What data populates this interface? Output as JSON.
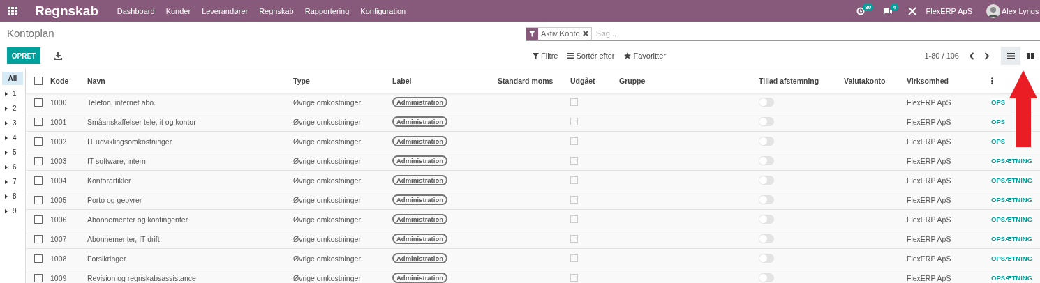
{
  "navbar": {
    "brand": "Regnskab",
    "menu": [
      "Dashboard",
      "Kunder",
      "Leverandører",
      "Regnskab",
      "Rapportering",
      "Konfiguration"
    ],
    "activity_badge": "30",
    "messages_badge": "4",
    "company": "FlexERP ApS",
    "user": "Alex Lyngs"
  },
  "breadcrumb": "Kontoplan",
  "create_button": "OPRET",
  "search": {
    "facet": "Aktiv Konto",
    "placeholder": "Søg..."
  },
  "search_options": [
    "Filtre",
    "Sortér efter",
    "Favoritter"
  ],
  "pager": "1-80 / 106",
  "views": [
    {
      "kind": "list",
      "selected": true
    },
    {
      "kind": "kanban",
      "selected": false
    }
  ],
  "sidebar": [
    {
      "label": "All",
      "selected": true,
      "expandable": false
    },
    {
      "label": "1",
      "selected": false,
      "expandable": true
    },
    {
      "label": "2",
      "selected": false,
      "expandable": true
    },
    {
      "label": "3",
      "selected": false,
      "expandable": true
    },
    {
      "label": "4",
      "selected": false,
      "expandable": true
    },
    {
      "label": "5",
      "selected": false,
      "expandable": true
    },
    {
      "label": "6",
      "selected": false,
      "expandable": true
    },
    {
      "label": "7",
      "selected": false,
      "expandable": true
    },
    {
      "label": "8",
      "selected": false,
      "expandable": true
    },
    {
      "label": "9",
      "selected": false,
      "expandable": true
    }
  ],
  "table": {
    "all_checked": false,
    "columns": [
      "Kode",
      "Navn",
      "Type",
      "Label",
      "Standard moms",
      "Udgået",
      "Gruppe",
      "Tillad afstemning",
      "Valutakonto",
      "Virksomhed"
    ],
    "rows": [
      {
        "checked": false,
        "code": "1000",
        "name": "Telefon, internet abo.",
        "type": "Øvrige omkostninger",
        "label": "Administration",
        "deprecated": false,
        "reconcile": false,
        "company": "FlexERP ApS",
        "action": "OPS"
      },
      {
        "checked": false,
        "code": "1001",
        "name": "Småanskaffelser tele, it og kontor",
        "type": "Øvrige omkostninger",
        "label": "Administration",
        "deprecated": false,
        "reconcile": false,
        "company": "FlexERP ApS",
        "action": "OPS"
      },
      {
        "checked": false,
        "code": "1002",
        "name": "IT udviklingsomkostninger",
        "type": "Øvrige omkostninger",
        "label": "Administration",
        "deprecated": false,
        "reconcile": false,
        "company": "FlexERP ApS",
        "action": "OPS"
      },
      {
        "checked": false,
        "code": "1003",
        "name": "IT software, intern",
        "type": "Øvrige omkostninger",
        "label": "Administration",
        "deprecated": false,
        "reconcile": false,
        "company": "FlexERP ApS",
        "action": "OPSÆTNING"
      },
      {
        "checked": false,
        "code": "1004",
        "name": "Kontorartikler",
        "type": "Øvrige omkostninger",
        "label": "Administration",
        "deprecated": false,
        "reconcile": false,
        "company": "FlexERP ApS",
        "action": "OPSÆTNING"
      },
      {
        "checked": false,
        "code": "1005",
        "name": "Porto og gebyrer",
        "type": "Øvrige omkostninger",
        "label": "Administration",
        "deprecated": false,
        "reconcile": false,
        "company": "FlexERP ApS",
        "action": "OPSÆTNING"
      },
      {
        "checked": false,
        "code": "1006",
        "name": "Abonnementer og kontingenter",
        "type": "Øvrige omkostninger",
        "label": "Administration",
        "deprecated": false,
        "reconcile": false,
        "company": "FlexERP ApS",
        "action": "OPSÆTNING"
      },
      {
        "checked": false,
        "code": "1007",
        "name": "Abonnementer, IT drift",
        "type": "Øvrige omkostninger",
        "label": "Administration",
        "deprecated": false,
        "reconcile": false,
        "company": "FlexERP ApS",
        "action": "OPSÆTNING"
      },
      {
        "checked": false,
        "code": "1008",
        "name": "Forsikringer",
        "type": "Øvrige omkostninger",
        "label": "Administration",
        "deprecated": false,
        "reconcile": false,
        "company": "FlexERP ApS",
        "action": "OPSÆTNING"
      },
      {
        "checked": false,
        "code": "1009",
        "name": "Revision og regnskabsassistance",
        "type": "Øvrige omkostninger",
        "label": "Administration",
        "deprecated": false,
        "reconcile": false,
        "company": "FlexERP ApS",
        "action": "OPSÆTNING"
      }
    ]
  }
}
